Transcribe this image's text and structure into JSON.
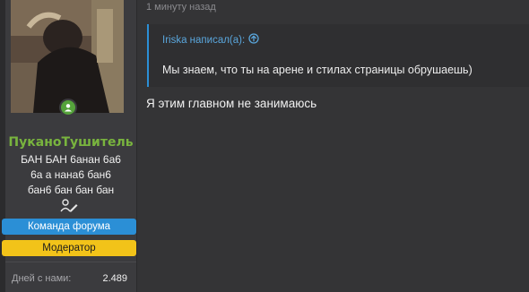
{
  "post": {
    "time": "1 минуту назад",
    "quote": {
      "header": "Iriska написал(а):",
      "text": "Мы знаем, что ты на арене и стилах страницы обрушаешь)"
    },
    "text": "Я этим главном не занимаюсь"
  },
  "author": {
    "username": "ПуканоТушитель",
    "title_lines": [
      "БАН БАН 6анан 6а6",
      "6а а нана6 бан6",
      "бан6 бан бан бан"
    ],
    "banners": [
      "Команда форума",
      "Модератор"
    ],
    "stats": {
      "label": "Дней с нами:",
      "value": "2.489"
    },
    "online_icon": "user-online-icon",
    "title_icon": "user-edit-icon"
  },
  "colors": {
    "username": "#79b43e",
    "team_banner": "#2b8fd6",
    "moderator_banner": "#f2c319",
    "quote_accent": "#2b8fd6"
  }
}
